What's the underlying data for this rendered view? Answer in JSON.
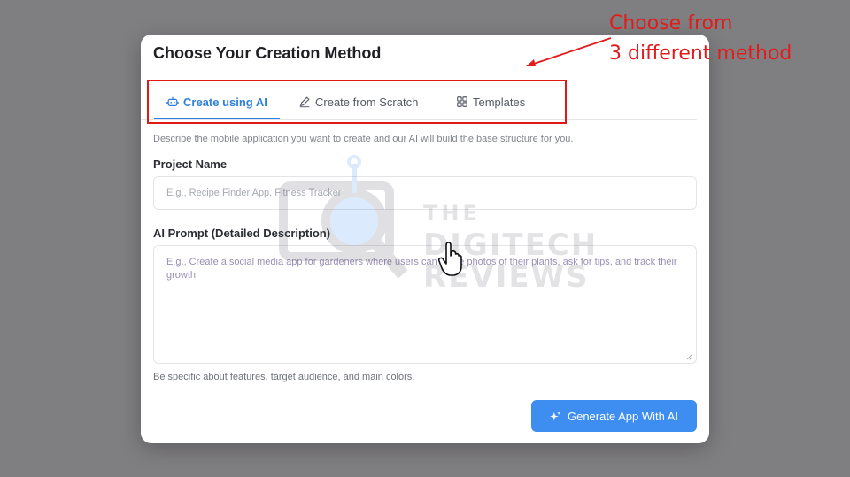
{
  "modal": {
    "title": "Choose Your Creation Method",
    "tabs": [
      {
        "label": "Create using AI",
        "icon": "robot-icon",
        "active": true
      },
      {
        "label": "Create from Scratch",
        "icon": "pencil-icon",
        "active": false
      },
      {
        "label": "Templates",
        "icon": "grid-icon",
        "active": false
      }
    ],
    "description": "Describe the mobile application you want to create and our AI will build the base structure for you.",
    "project_name": {
      "label": "Project Name",
      "placeholder": "E.g., Recipe Finder App, Fitness Tracker",
      "value": ""
    },
    "ai_prompt": {
      "label": "AI Prompt (Detailed Description)",
      "placeholder": "E.g., Create a social media app for gardeners where users can share photos of their plants, ask for tips, and track their growth.",
      "value": ""
    },
    "hint": "Be specific about features, target audience, and main colors.",
    "generate_button": {
      "label": "Generate App With AI",
      "icon": "sparkle-icon"
    }
  },
  "annotation": {
    "line1": "Choose from",
    "line2": "3 different method",
    "color": "#e21b1b"
  },
  "watermark": {
    "line1": "THE",
    "line2": "DIGITECH",
    "line3": "REVIEWS"
  },
  "colors": {
    "accent": "#3d8ef0",
    "active_tab": "#2f7fe0",
    "backdrop": "#7f7e81"
  }
}
